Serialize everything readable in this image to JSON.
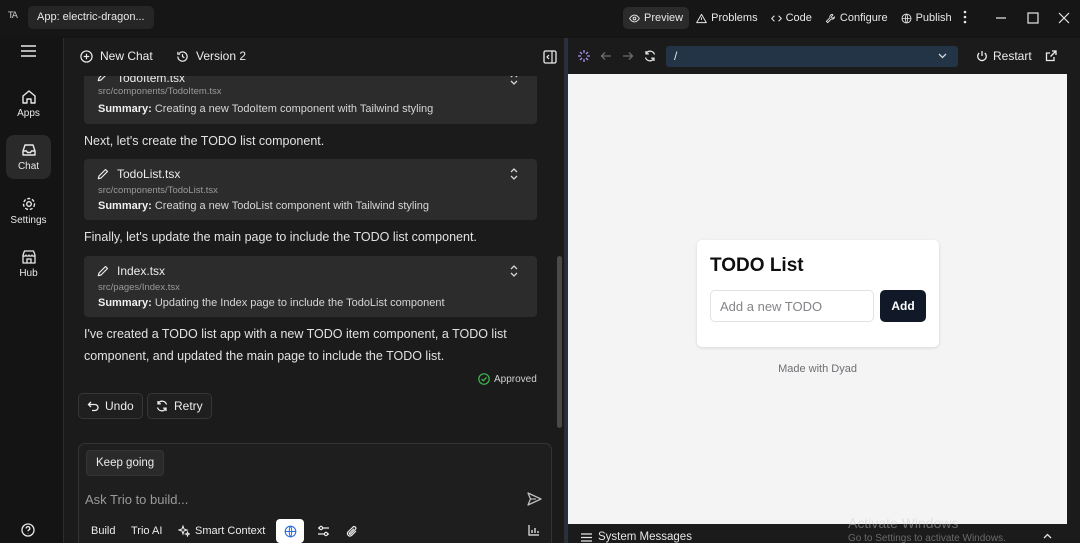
{
  "titlebar": {
    "logo": "TA",
    "app_chip": "App: electric-dragon...",
    "actions": [
      "Preview",
      "Problems",
      "Code",
      "Configure",
      "Publish"
    ]
  },
  "nav": {
    "items": [
      "Apps",
      "Chat",
      "Settings",
      "Hub"
    ]
  },
  "chat": {
    "new_chat": "New Chat",
    "version": "Version 2",
    "cards": [
      {
        "name": "TodoItem.tsx",
        "path": "src/components/TodoItem.tsx",
        "summary_label": "Summary:",
        "summary": "Creating a new TodoItem component with Tailwind styling"
      },
      {
        "name": "TodoList.tsx",
        "path": "src/components/TodoList.tsx",
        "summary_label": "Summary:",
        "summary": "Creating a new TodoList component with Tailwind styling"
      },
      {
        "name": "Index.tsx",
        "path": "src/pages/Index.tsx",
        "summary_label": "Summary:",
        "summary": "Updating the Index page to include the TodoList component"
      }
    ],
    "messages": [
      "Next, let's create the TODO list component.",
      "Finally, let's update the main page to include the TODO list component.",
      "I've created a TODO list app with a new TODO item component, a TODO list",
      "component, and updated the main page to include the TODO list."
    ],
    "approved": "Approved",
    "undo": "Undo",
    "retry": "Retry",
    "keep_going": "Keep going",
    "input_placeholder": "Ask Trio to build...",
    "tools": [
      "Build",
      "Trio AI",
      "Smart Context"
    ]
  },
  "preview": {
    "url": "/",
    "restart": "Restart",
    "todo_title": "TODO List",
    "todo_placeholder": "Add a new TODO",
    "todo_add": "Add",
    "made_with": "Made with Dyad",
    "system_messages": "System Messages"
  },
  "watermark": {
    "line1": "Activate Windows",
    "line2": "Go to Settings to activate Windows."
  },
  "colors": {
    "background": "#141414",
    "panel": "#1b1b1b",
    "card": "#2c2c2c",
    "url_bar": "#243447",
    "add_button": "#111827",
    "approved_green": "#3fb950"
  }
}
